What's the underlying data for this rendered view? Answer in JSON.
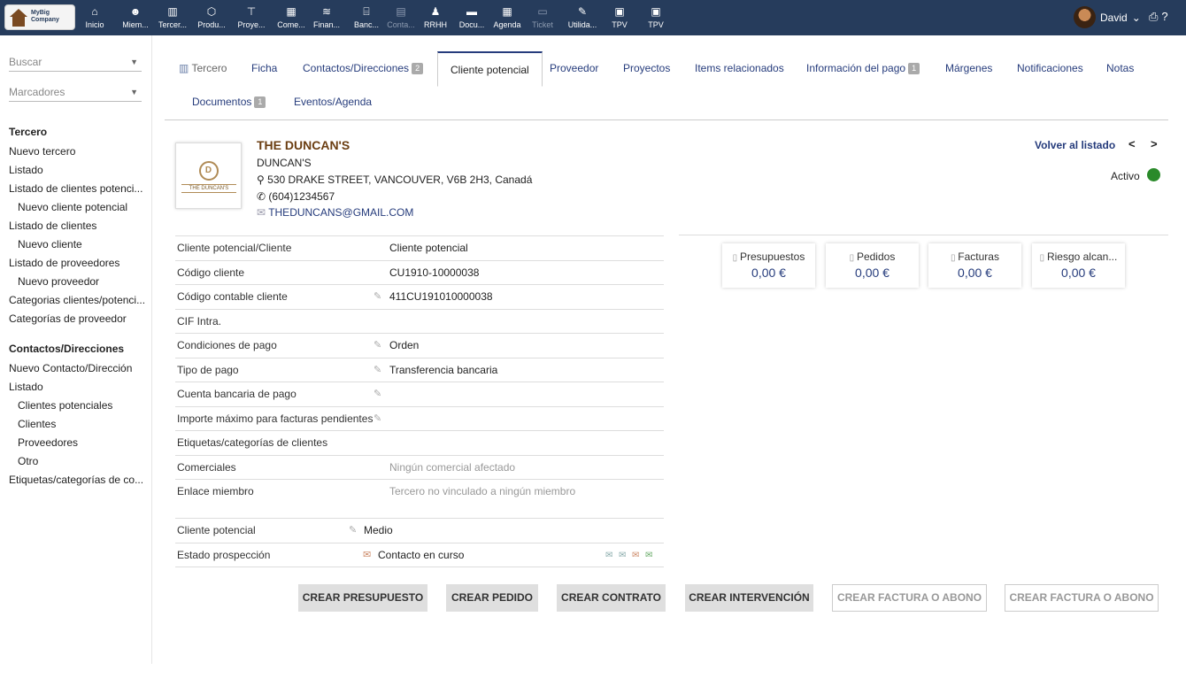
{
  "topbar": {
    "logo_text": "MyBig Company",
    "menus": [
      {
        "icon": "home-icon",
        "glyph": "⌂",
        "label": "Inicio"
      },
      {
        "icon": "members-icon",
        "glyph": "☻",
        "label": "Miem..."
      },
      {
        "icon": "building-icon",
        "glyph": "▥",
        "label": "Tercer..."
      },
      {
        "icon": "cube-icon",
        "glyph": "⬡",
        "label": "Produ..."
      },
      {
        "icon": "sitemap-icon",
        "glyph": "⊤",
        "label": "Proye..."
      },
      {
        "icon": "suitcase-icon",
        "glyph": "▦",
        "label": "Come..."
      },
      {
        "icon": "coins-icon",
        "glyph": "≋",
        "label": "Finan..."
      },
      {
        "icon": "bank-icon",
        "glyph": "⌸",
        "label": "Banc..."
      },
      {
        "icon": "accounting-icon",
        "glyph": "▤",
        "label": "Conta...",
        "dim": true
      },
      {
        "icon": "person-tie-icon",
        "glyph": "♟",
        "label": "RRHH"
      },
      {
        "icon": "folder-icon",
        "glyph": "▬",
        "label": "Docu..."
      },
      {
        "icon": "calendar-icon",
        "glyph": "▦",
        "label": "Agenda"
      },
      {
        "icon": "ticket-icon",
        "glyph": "▭",
        "label": "Ticket",
        "dim": true
      },
      {
        "icon": "wrench-icon",
        "glyph": "✎",
        "label": "Utilida..."
      },
      {
        "icon": "cash-register-icon",
        "glyph": "▣",
        "label": "TPV"
      },
      {
        "icon": "cash-register-icon-2",
        "glyph": "▣",
        "label": "TPV"
      }
    ],
    "user_name": "David",
    "user_caret": "⌄",
    "print_glyph": "⎙",
    "help_glyph": "?"
  },
  "left": {
    "search_placeholder": "Buscar",
    "bookmarks": "Marcadores",
    "caret": "▼",
    "items": [
      {
        "label": "Tercero",
        "type": "hd"
      },
      {
        "label": "Nuevo tercero",
        "type": "n"
      },
      {
        "label": "Listado",
        "type": "n"
      },
      {
        "label": "Listado de clientes potenci...",
        "type": "n"
      },
      {
        "label": "Nuevo cliente potencial",
        "type": "sub"
      },
      {
        "label": "Listado de clientes",
        "type": "n"
      },
      {
        "label": "Nuevo cliente",
        "type": "sub"
      },
      {
        "label": "Listado de proveedores",
        "type": "n"
      },
      {
        "label": "Nuevo proveedor",
        "type": "sub"
      },
      {
        "label": "Categorias clientes/potenci...",
        "type": "n"
      },
      {
        "label": "Categorías de proveedor",
        "type": "n"
      },
      {
        "label": "Contactos/Direcciones",
        "type": "hd"
      },
      {
        "label": "Nuevo Contacto/Dirección",
        "type": "n"
      },
      {
        "label": "Listado",
        "type": "n"
      },
      {
        "label": "Clientes potenciales",
        "type": "sub"
      },
      {
        "label": "Clientes",
        "type": "sub"
      },
      {
        "label": "Proveedores",
        "type": "sub"
      },
      {
        "label": "Otro",
        "type": "sub"
      },
      {
        "label": "Etiquetas/categorías de co...",
        "type": "n"
      }
    ]
  },
  "tabs": {
    "tercero": "Tercero",
    "ficha": "Ficha",
    "contactos": "Contactos/Direcciones",
    "contactos_count": "2",
    "cliente_potencial": "Cliente potencial",
    "proveedor": "Proveedor",
    "proyectos": "Proyectos",
    "items": "Items relacionados",
    "info_pago": "Información del pago",
    "info_pago_count": "1",
    "margenes": "Márgenes",
    "notificaciones": "Notificaciones",
    "notas": "Notas",
    "documentos": "Documentos",
    "documentos_count": "1",
    "eventos": "Eventos/Agenda"
  },
  "company": {
    "logo_monogram": "D",
    "logo_banner": "THE DUNCAN'S",
    "name": "THE DUNCAN'S",
    "alias": "DUNCAN'S",
    "address": "530 DRAKE STREET, VANCOUVER, V6B 2H3, Canadá",
    "phone": "(604)1234567",
    "email": "THEDUNCANS@GMAIL.COM",
    "back_link": "Volver al listado",
    "status": "Activo"
  },
  "fields": [
    {
      "label": "Cliente potencial/Cliente",
      "value": "Cliente potencial",
      "editable": false,
      "light": false
    },
    {
      "label": "Código cliente",
      "value": "CU1910-10000038",
      "editable": false,
      "light": false
    },
    {
      "label": "Código contable cliente",
      "value": "411CU191010000038",
      "editable": true,
      "light": false
    },
    {
      "label": "CIF Intra.",
      "value": "",
      "editable": false,
      "light": false
    },
    {
      "label": "Condiciones de pago",
      "value": "Orden",
      "editable": true,
      "light": false
    },
    {
      "label": "Tipo de pago",
      "value": "Transferencia bancaria",
      "editable": true,
      "light": false
    },
    {
      "label": "Cuenta bancaria de pago",
      "value": "",
      "editable": true,
      "light": false
    },
    {
      "label": "Importe máximo para facturas pendientes",
      "value": "",
      "editable": true,
      "light": false
    },
    {
      "label": "Etiquetas/categorías de clientes",
      "value": "",
      "editable": false,
      "light": false
    },
    {
      "label": "Comerciales",
      "value": "Ningún comercial afectado",
      "editable": false,
      "light": true
    },
    {
      "label": "Enlace miembro",
      "value": "Tercero no vinculado a ningún miembro",
      "editable": false,
      "light": true
    }
  ],
  "prospect": {
    "level_label": "Cliente potencial",
    "level_value": "Medio",
    "state_label": "Estado prospección",
    "state_value": "Contacto en curso"
  },
  "cards": [
    {
      "title": "Presupuestos",
      "amount": "0,00 €"
    },
    {
      "title": "Pedidos",
      "amount": "0,00 €"
    },
    {
      "title": "Facturas",
      "amount": "0,00 €"
    },
    {
      "title": "Riesgo alcan...",
      "amount": "0,00 €"
    }
  ],
  "buttons": [
    {
      "label": "CREAR PRESUPUESTO",
      "enabled": true
    },
    {
      "label": "CREAR PEDIDO",
      "enabled": true
    },
    {
      "label": "CREAR CONTRATO",
      "enabled": true
    },
    {
      "label": "CREAR INTERVENCIÓN",
      "enabled": true
    },
    {
      "label": "CREAR FACTURA O ABONO",
      "enabled": false
    },
    {
      "label": "CREAR FACTURA O ABONO",
      "enabled": false
    }
  ]
}
